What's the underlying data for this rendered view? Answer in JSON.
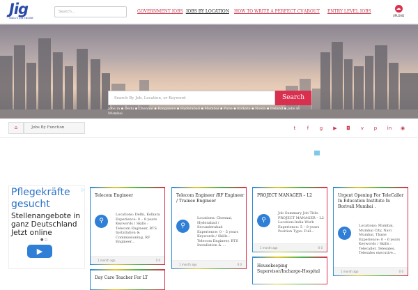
{
  "header": {
    "logo_big": "Jig",
    "logo_small": "INDIA'S JOB ENGINE",
    "search_placeholder": "Search...",
    "nav": [
      "GOVERNMENT JOBS",
      "JOBS BY LOCATION",
      "HOW TO WRITE A PERFECT CV",
      "ABOUT",
      "ENTRY LEVEL JOBS"
    ],
    "upload_label": "UPLOAD"
  },
  "hero": {
    "search_placeholder": "Search By Job, Location, or Keyword",
    "search_button": "Search",
    "links": "Jobs in ▪ Delhi ▪ Chennai ▪ Bangalore ▪ Hyderabad ▪ Mumbai ▪ Pune ▪ Kolkata ▪ Noida ▪ Ireland ▪ Jobs in Mumbai"
  },
  "breadcrumb": {
    "item": "Jobs By Function"
  },
  "social_icons": [
    "twitter-icon",
    "facebook-icon",
    "googleplus-icon",
    "youtube-icon",
    "instagram-icon",
    "vine-icon",
    "pinterest-icon",
    "linkedin-icon",
    "rss-icon"
  ],
  "ad": {
    "headline": "Pflegekräfte gesucht",
    "text": "Stellenangebote in ganz Deutschland Jetzt online",
    "button": "▶"
  },
  "cards": [
    {
      "title": "Telecom Engineer",
      "body": "Locations: Delhi, Kolkata Experience: 0 – 8 years Keywords / Skills : Telecom Engineer, BTS Installation & Commissioning, RF Engineer...",
      "age": "1 month ago",
      "stats": "0   0"
    },
    {
      "title": "Telecom Engineer /RF Engineer / Trainee Engineer",
      "body": "Locations: Chennai, Hyderabad / Secunderabad Experience: 0 – 5 years Keywords / Skills : Telecom Engineer, BTS Installation & ...",
      "age": "1 month ago",
      "stats": "0   0"
    },
    {
      "title": "PROJECT MANAGER – L2",
      "body": "Job Summary Job Title: PROJECT MANAGER – L2 Location:India Work Experience: 5 – 8 years Position Type: Full...",
      "age": "1 month ago",
      "stats": "0   0"
    },
    {
      "title": "Urgent Opening For TeleCaller In Education Institute In Borivali Mumbai .",
      "body": "Locations: Mumbai, Mumbai City, Navi Mumbai, Thane Experience: 0 – 6 years Keywords / Skills : Telecaller, Telesales, Telesales executive...",
      "age": "1 month ago",
      "stats": "0   0"
    },
    {
      "title": "Housekeeping Supervisor/Incharge-Hospital",
      "body": "",
      "age": "",
      "stats": ""
    },
    {
      "title": "Day Care Teacher For LT",
      "body": "",
      "age": "",
      "stats": ""
    }
  ]
}
